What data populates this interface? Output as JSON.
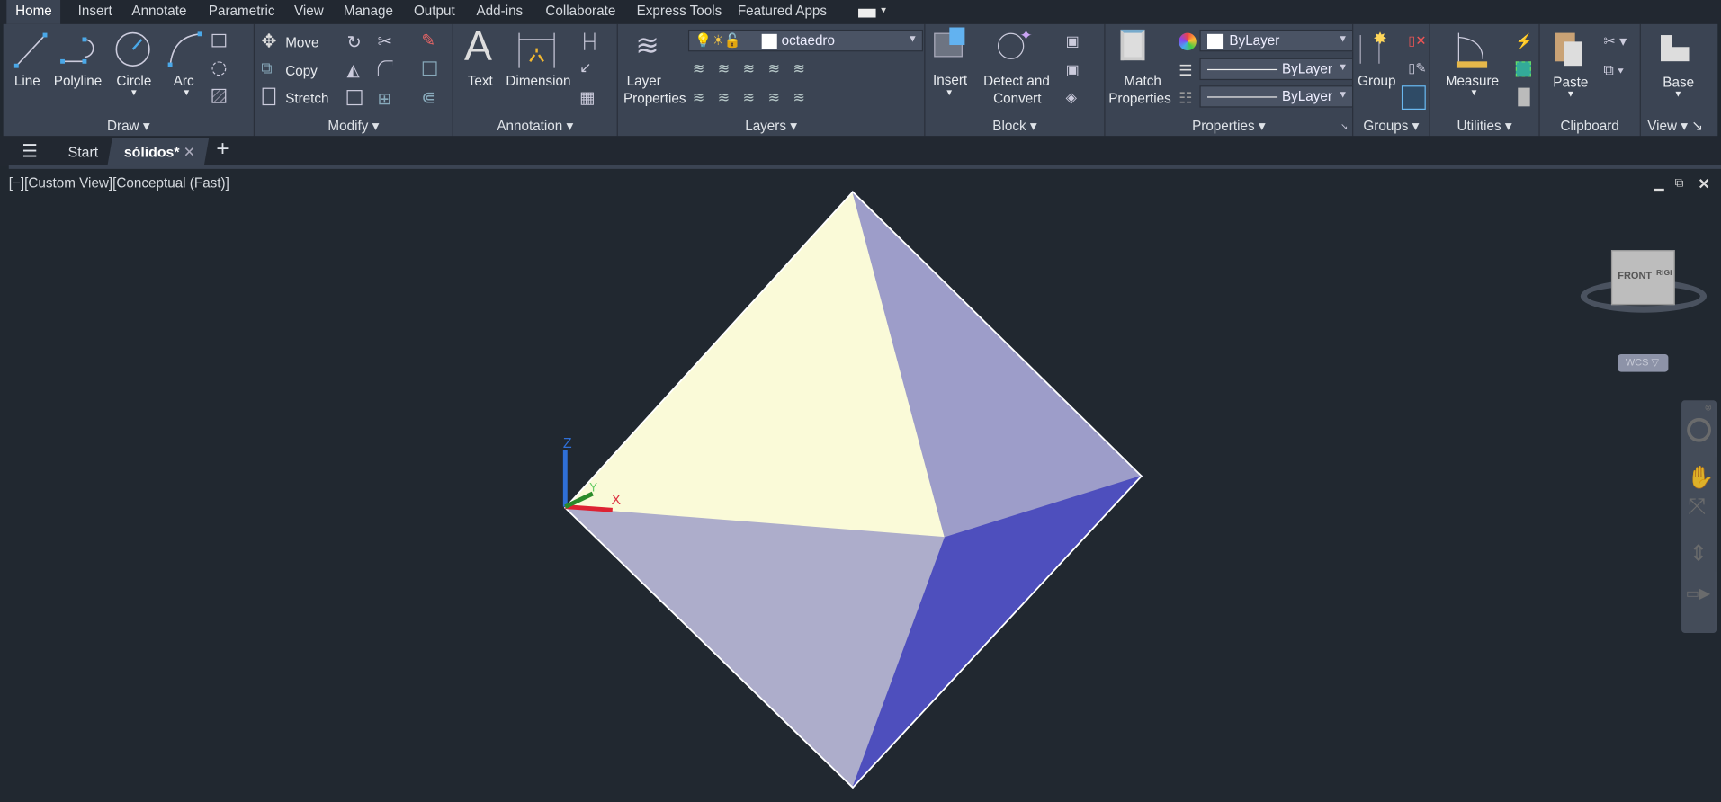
{
  "ribbon_tabs": [
    "Home",
    "Insert",
    "Annotate",
    "Parametric",
    "View",
    "Manage",
    "Output",
    "Add-ins",
    "Collaborate",
    "Express Tools",
    "Featured Apps"
  ],
  "panels": {
    "draw": {
      "title": "Draw",
      "line": "Line",
      "polyline": "Polyline",
      "circle": "Circle",
      "arc": "Arc"
    },
    "modify": {
      "title": "Modify",
      "move": "Move",
      "copy": "Copy",
      "stretch": "Stretch"
    },
    "annotation": {
      "title": "Annotation",
      "text": "Text",
      "dimension": "Dimension"
    },
    "layers": {
      "title": "Layers",
      "layer_properties_1": "Layer",
      "layer_properties_2": "Properties",
      "current_layer": "octaedro"
    },
    "block": {
      "title": "Block",
      "insert": "Insert",
      "detect_1": "Detect and",
      "detect_2": "Convert"
    },
    "properties": {
      "title": "Properties",
      "match_1": "Match",
      "match_2": "Properties",
      "color": "ByLayer",
      "linetype": "ByLayer",
      "lineweight": "ByLayer"
    },
    "groups": {
      "title": "Groups",
      "group": "Group"
    },
    "utilities": {
      "title": "Utilities",
      "measure": "Measure"
    },
    "clipboard": {
      "title": "Clipboard",
      "paste": "Paste"
    },
    "view": {
      "title": "View",
      "base": "Base"
    }
  },
  "file_tabs": {
    "start": "Start",
    "current": "sólidos*",
    "close": "✕",
    "add": "+"
  },
  "viewport": {
    "label": "[−][Custom View][Conceptual (Fast)]",
    "viewcube_front": "FRONT",
    "viewcube_right": "RIGHT",
    "ucs": "WCS",
    "axis_x": "X",
    "axis_y": "Y",
    "axis_z": "Z"
  },
  "colors": {
    "face_top_left": "#fafad8",
    "face_top_right": "#9d9dc9",
    "face_bottom_left": "#adadcb",
    "face_bottom_right": "#4e4fbd",
    "viewport_bg": "#212830",
    "ribbon_bg": "#3b4453"
  }
}
